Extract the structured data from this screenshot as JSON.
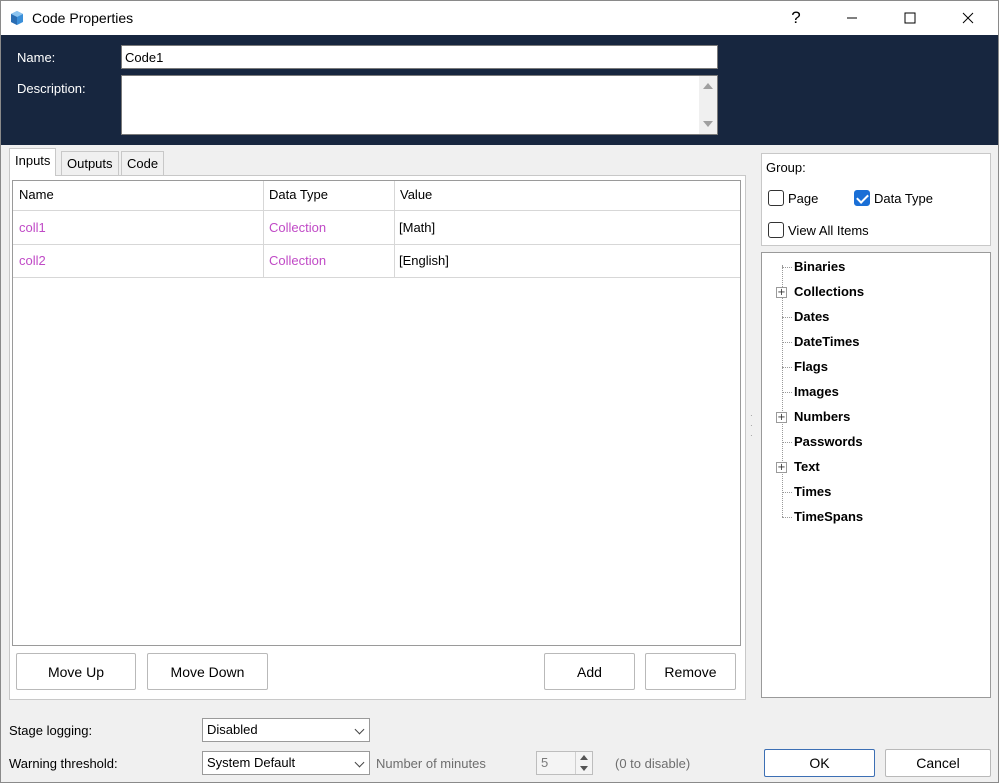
{
  "window": {
    "title": "Code Properties",
    "help_label": "?",
    "minimize_label": "—",
    "maximize_label": "☐",
    "close_label": "✕"
  },
  "header": {
    "name_label": "Name:",
    "name_value": "Code1",
    "description_label": "Description:",
    "description_value": ""
  },
  "tabs": [
    {
      "label": "Inputs",
      "active": true
    },
    {
      "label": "Outputs",
      "active": false
    },
    {
      "label": "Code",
      "active": false
    }
  ],
  "grid": {
    "columns": [
      "Name",
      "Data Type",
      "Value"
    ],
    "rows": [
      {
        "name": "coll1",
        "data_type": "Collection",
        "value": "[Math]"
      },
      {
        "name": "coll2",
        "data_type": "Collection",
        "value": "[English]"
      }
    ]
  },
  "buttons": {
    "move_up": "Move Up",
    "move_down": "Move Down",
    "add": "Add",
    "remove": "Remove",
    "ok": "OK",
    "cancel": "Cancel"
  },
  "group": {
    "label": "Group:",
    "page_label": "Page",
    "page_checked": false,
    "data_type_label": "Data Type",
    "data_type_checked": true,
    "view_all_label": "View All Items",
    "view_all_checked": false
  },
  "tree": {
    "items": [
      {
        "label": "Binaries",
        "expandable": false
      },
      {
        "label": "Collections",
        "expandable": true
      },
      {
        "label": "Dates",
        "expandable": false
      },
      {
        "label": "DateTimes",
        "expandable": false
      },
      {
        "label": "Flags",
        "expandable": false
      },
      {
        "label": "Images",
        "expandable": false
      },
      {
        "label": "Numbers",
        "expandable": true
      },
      {
        "label": "Passwords",
        "expandable": false
      },
      {
        "label": "Text",
        "expandable": true
      },
      {
        "label": "Times",
        "expandable": false
      },
      {
        "label": "TimeSpans",
        "expandable": false
      }
    ]
  },
  "footer": {
    "stage_logging_label": "Stage logging:",
    "stage_logging_value": "Disabled",
    "warning_threshold_label": "Warning threshold:",
    "warning_threshold_value": "System Default",
    "minutes_label": "Number of minutes",
    "minutes_value": "5",
    "disable_hint": "(0 to disable)"
  },
  "colors": {
    "header_bg": "#17263f",
    "variable_text": "#c04ac6",
    "checkbox_checked": "#1a6fd6"
  }
}
